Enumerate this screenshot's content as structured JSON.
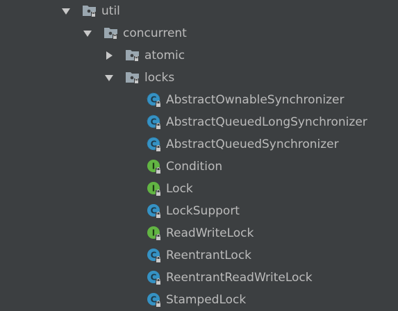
{
  "colors": {
    "background": "#3c3f41",
    "text": "#bbbbbb",
    "class_icon": "#3592c4",
    "interface_icon": "#62b543",
    "folder_icon": "#9aa7b0",
    "arrow": "#c8c8c8"
  },
  "tree": {
    "util": {
      "label": "util",
      "state": "expanded",
      "icon": "package-icon"
    },
    "concurrent": {
      "label": "concurrent",
      "state": "expanded",
      "icon": "package-icon"
    },
    "atomic": {
      "label": "atomic",
      "state": "collapsed",
      "icon": "package-icon"
    },
    "locks": {
      "label": "locks",
      "state": "expanded",
      "icon": "package-icon",
      "items": [
        {
          "label": "AbstractOwnableSynchronizer",
          "kind": "abstract-class",
          "letter": "C"
        },
        {
          "label": "AbstractQueuedLongSynchronizer",
          "kind": "abstract-class",
          "letter": "C"
        },
        {
          "label": "AbstractQueuedSynchronizer",
          "kind": "abstract-class",
          "letter": "C"
        },
        {
          "label": "Condition",
          "kind": "interface",
          "letter": "I"
        },
        {
          "label": "Lock",
          "kind": "interface",
          "letter": "I"
        },
        {
          "label": "LockSupport",
          "kind": "class",
          "letter": "C"
        },
        {
          "label": "ReadWriteLock",
          "kind": "interface",
          "letter": "I"
        },
        {
          "label": "ReentrantLock",
          "kind": "class",
          "letter": "C"
        },
        {
          "label": "ReentrantReadWriteLock",
          "kind": "class",
          "letter": "C"
        },
        {
          "label": "StampedLock",
          "kind": "class",
          "letter": "C"
        }
      ]
    }
  }
}
